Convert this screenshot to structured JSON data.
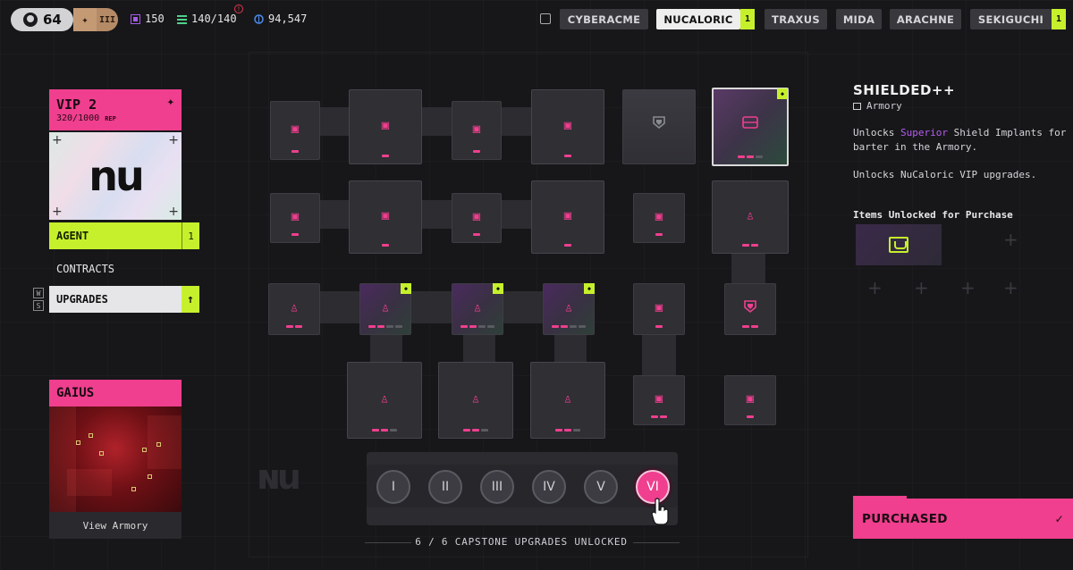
{
  "topbar": {
    "level": "64",
    "rank": "III",
    "stat1": "150",
    "stat2": "140/140",
    "stat3": "94,547",
    "factions": [
      "CYBERACME",
      "NUCALORIC",
      "TRAXUS",
      "MIDA",
      "ARACHNE",
      "SEKIGUCHI"
    ],
    "active_faction": "NUCALORIC",
    "nucaloric_count": "1",
    "sekiguchi_count": "1"
  },
  "left": {
    "vip_title": "VIP 2",
    "vip_rep_value": "320/1000",
    "vip_rep_unit": "REP",
    "logo_text": "nu",
    "agent_label": "AGENT",
    "agent_count": "1",
    "contracts_label": "CONTRACTS",
    "upgrades_label": "UPGRADES",
    "key_w": "W",
    "key_s": "S",
    "gaius_title": "GAIUS",
    "gaius_link": "View Armory"
  },
  "tree": {
    "capstone": [
      "I",
      "II",
      "III",
      "IV",
      "V",
      "VI"
    ],
    "capstone_active": "VI",
    "capstone_label": "6 / 6 CAPSTONE UPGRADES UNLOCKED"
  },
  "right": {
    "title": "SHIELDED++",
    "category": "Armory",
    "desc_pre": "Unlocks ",
    "desc_hl": "Superior",
    "desc_post": " Shield Implants for barter in the Armory.",
    "desc2": "Unlocks NuCaloric VIP upgrades.",
    "items_title": "Items Unlocked for Purchase",
    "status": "PURCHASED"
  },
  "colors": {
    "accent_pink": "#ef3f8e",
    "accent_lime": "#c6f02c",
    "highlight_purple": "#b75cf0",
    "background": "#17171a"
  }
}
